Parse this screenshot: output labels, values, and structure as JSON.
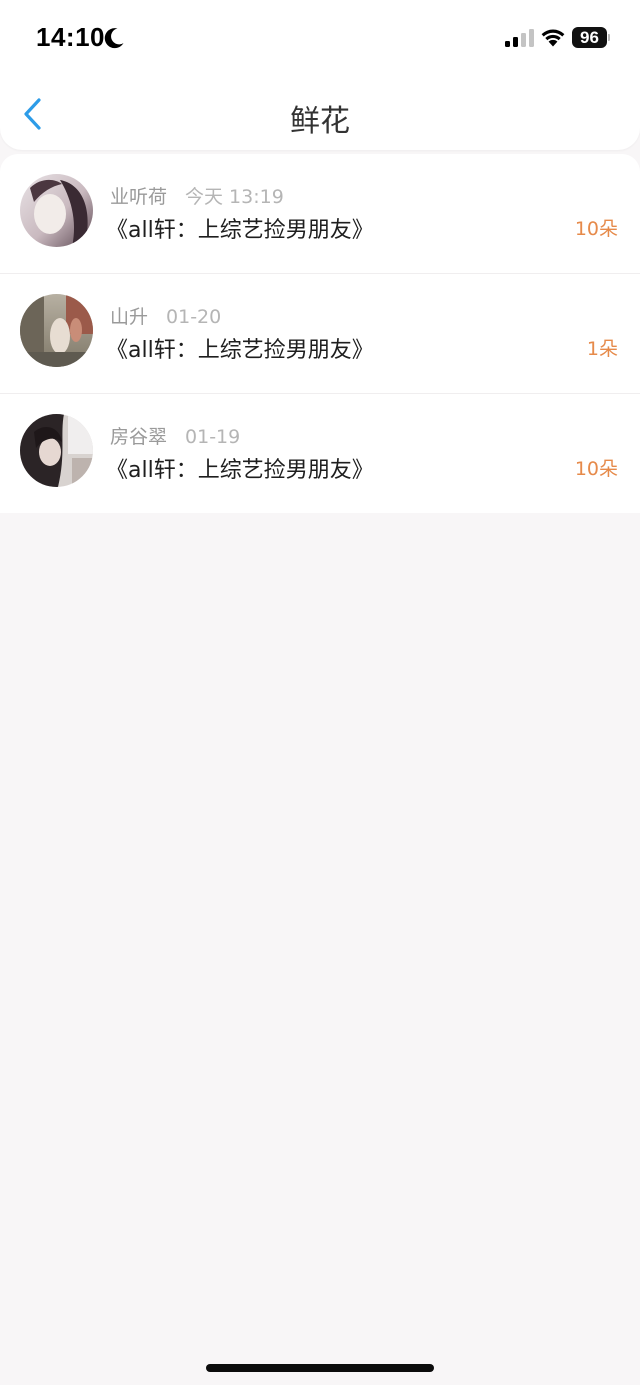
{
  "status_bar": {
    "time": "14:10",
    "battery": "96"
  },
  "header": {
    "title": "鲜花"
  },
  "list": {
    "items": [
      {
        "name": "业听荷",
        "time": "今天 13:19",
        "title": "《all轩：上综艺捡男朋友》",
        "amount": "10朵"
      },
      {
        "name": "山升",
        "time": "01-20",
        "title": "《all轩：上综艺捡男朋友》",
        "amount": "1朵"
      },
      {
        "name": "房谷翠",
        "time": "01-19",
        "title": "《all轩：上综艺捡男朋友》",
        "amount": "10朵"
      }
    ]
  },
  "colors": {
    "accent": "#2d9ce8",
    "amount": "#e68a4a",
    "background": "#f8f6f7"
  },
  "icons": {
    "back": "chevron-left-icon",
    "moon": "moon-icon",
    "signal": "cellular-signal-icon",
    "wifi": "wifi-icon",
    "battery": "battery-icon"
  }
}
